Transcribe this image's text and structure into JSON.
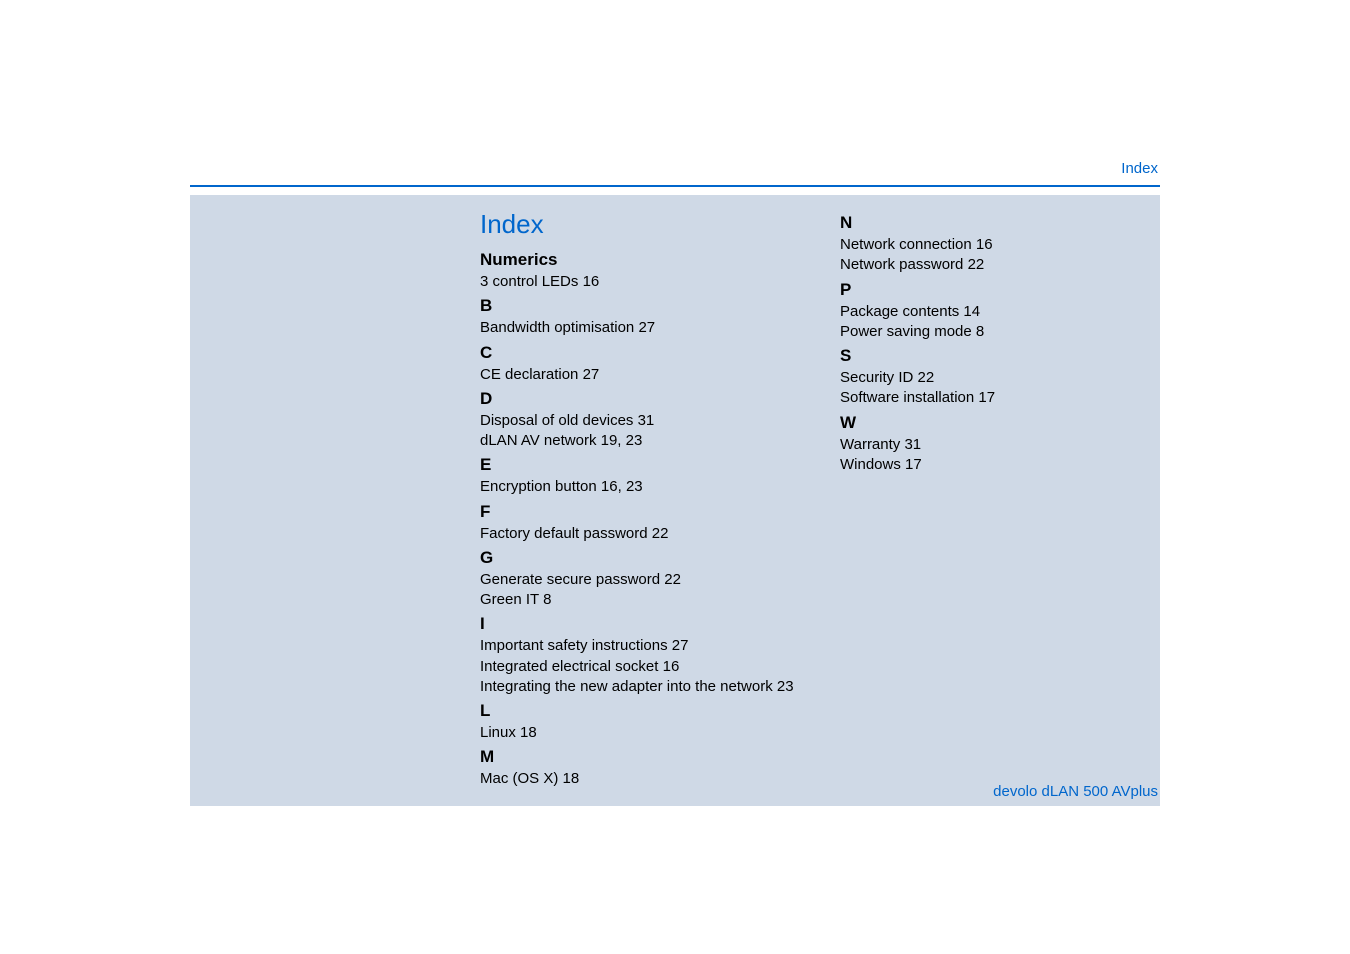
{
  "header": {
    "label": "Index"
  },
  "title": "Index",
  "column1": {
    "sections": [
      {
        "heading": "Numerics",
        "entries": [
          {
            "text": "3 control LEDs",
            "pages": "16"
          }
        ]
      },
      {
        "heading": "B",
        "entries": [
          {
            "text": "Bandwidth optimisation",
            "pages": "27"
          }
        ]
      },
      {
        "heading": "C",
        "entries": [
          {
            "text": "CE declaration",
            "pages": "27"
          }
        ]
      },
      {
        "heading": "D",
        "entries": [
          {
            "text": "Disposal of old devices",
            "pages": "31"
          },
          {
            "text": "dLAN AV network",
            "pages": "19,  23"
          }
        ]
      },
      {
        "heading": "E",
        "entries": [
          {
            "text": "Encryption button",
            "pages": "16,  23"
          }
        ]
      },
      {
        "heading": "F",
        "entries": [
          {
            "text": "Factory default password",
            "pages": "22"
          }
        ]
      },
      {
        "heading": "G",
        "entries": [
          {
            "text": "Generate secure password",
            "pages": "22"
          },
          {
            "text": "Green IT",
            "pages": "8"
          }
        ]
      },
      {
        "heading": "I",
        "entries": [
          {
            "text": "Important safety instructions",
            "pages": "27"
          },
          {
            "text": "Integrated electrical socket",
            "pages": "16"
          },
          {
            "text": "Integrating the new adapter into the network",
            "pages": "23"
          }
        ]
      },
      {
        "heading": "L",
        "entries": [
          {
            "text": "Linux",
            "pages": "18"
          }
        ]
      },
      {
        "heading": "M",
        "entries": [
          {
            "text": "Mac (OS X)",
            "pages": "18"
          }
        ]
      }
    ]
  },
  "column2": {
    "sections": [
      {
        "heading": "N",
        "entries": [
          {
            "text": "Network connection",
            "pages": "16"
          },
          {
            "text": "Network password",
            "pages": "22"
          }
        ]
      },
      {
        "heading": "P",
        "entries": [
          {
            "text": "Package contents",
            "pages": "14"
          },
          {
            "text": "Power saving mode",
            "pages": "8"
          }
        ]
      },
      {
        "heading": "S",
        "entries": [
          {
            "text": "Security ID",
            "pages": "22"
          },
          {
            "text": "Software installation",
            "pages": "17"
          }
        ]
      },
      {
        "heading": "W",
        "entries": [
          {
            "text": "Warranty",
            "pages": "31"
          },
          {
            "text": "Windows",
            "pages": "17"
          }
        ]
      }
    ]
  },
  "footer": {
    "product": "devolo dLAN 500 AVplus"
  }
}
